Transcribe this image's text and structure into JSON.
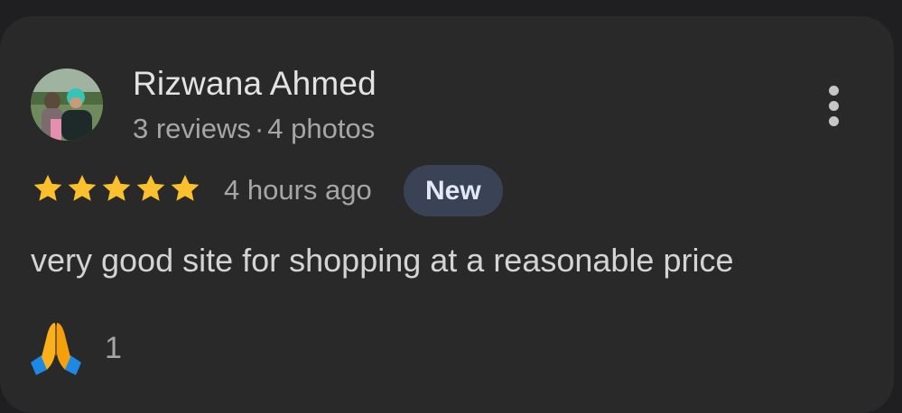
{
  "reviewer": {
    "name": "Rizwana Ahmed",
    "reviews": "3 reviews",
    "separator": "·",
    "photos": "4 photos"
  },
  "rating": {
    "stars": 5,
    "max": 5,
    "star_color": "#fbc02d"
  },
  "time_ago": "4 hours ago",
  "badge_label": "New",
  "review_text": "very good site for shopping at a reasonable price",
  "reaction": {
    "icon": "folded-hands-emoji",
    "count": "1"
  },
  "more_icon": "more-vertical-icon"
}
